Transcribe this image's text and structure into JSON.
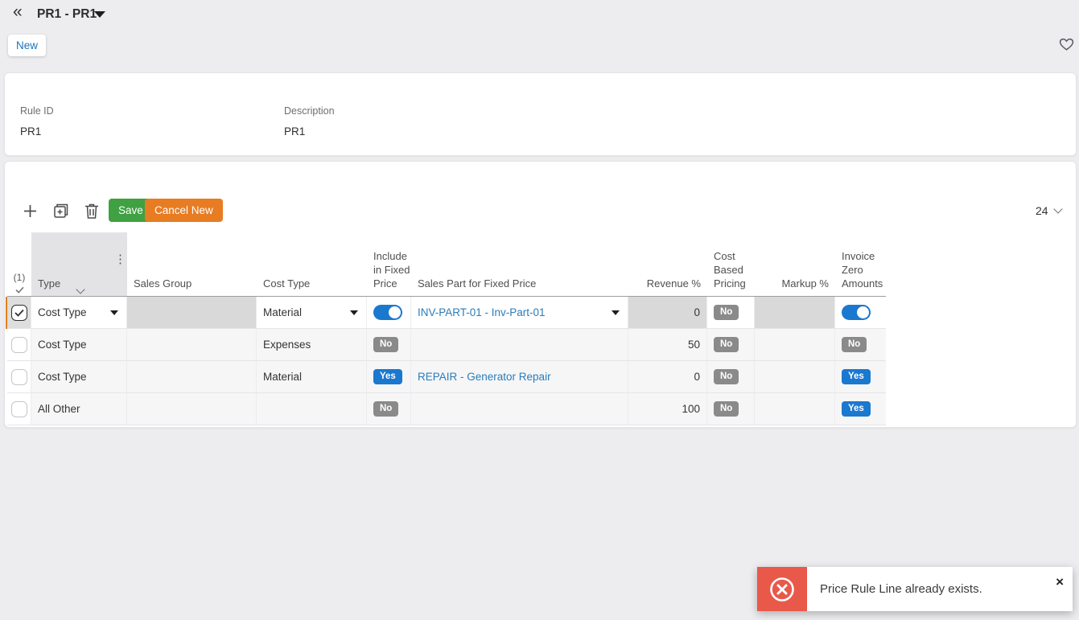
{
  "header": {
    "title": "PR1 - PR1"
  },
  "actions": {
    "new_label": "New"
  },
  "form": {
    "rule_id_label": "Rule ID",
    "rule_id_value": "PR1",
    "description_label": "Description",
    "description_value": "PR1"
  },
  "toolbar": {
    "save_label": "Save",
    "cancel_label": "Cancel New",
    "page_size": "24"
  },
  "table": {
    "selection_header": "(1)",
    "columns": {
      "type": "Type",
      "sales_group": "Sales Group",
      "cost_type": "Cost Type",
      "include_in_fixed_price": "Include in Fixed Price",
      "sales_part": "Sales Part for Fixed Price",
      "revenue": "Revenue %",
      "cost_based_pricing": "Cost Based Pricing",
      "markup": "Markup %",
      "invoice_zero_amounts": "Invoice Zero Amounts"
    },
    "rows": [
      {
        "type": "Cost Type",
        "sales_group": "",
        "cost_type": "Material",
        "include_in_fixed_price": "On",
        "sales_part": "INV-PART-01 - Inv-Part-01",
        "revenue": "0",
        "cost_based_pricing": "No",
        "markup": "",
        "invoice_zero_amounts": "On"
      },
      {
        "type": "Cost Type",
        "sales_group": "",
        "cost_type": "Expenses",
        "include_in_fixed_price": "No",
        "sales_part": "",
        "revenue": "50",
        "cost_based_pricing": "No",
        "markup": "",
        "invoice_zero_amounts": "No"
      },
      {
        "type": "Cost Type",
        "sales_group": "",
        "cost_type": "Material",
        "include_in_fixed_price": "Yes",
        "sales_part": "REPAIR - Generator Repair",
        "revenue": "0",
        "cost_based_pricing": "No",
        "markup": "",
        "invoice_zero_amounts": "Yes"
      },
      {
        "type": "All Other",
        "sales_group": "",
        "cost_type": "",
        "include_in_fixed_price": "No",
        "sales_part": "",
        "revenue": "100",
        "cost_based_pricing": "No",
        "markup": "",
        "invoice_zero_amounts": "Yes"
      }
    ]
  },
  "toast": {
    "message": "Price Rule Line already exists.",
    "close_label": "×"
  },
  "colors": {
    "accent_blue": "#1b78cf",
    "save_green": "#3fa142",
    "cancel_orange": "#e87c22",
    "toast_red": "#e8594a",
    "badge_grey": "#8a8a8a",
    "link_blue": "#2b7cba",
    "selected_row_orange": "#e08019"
  }
}
